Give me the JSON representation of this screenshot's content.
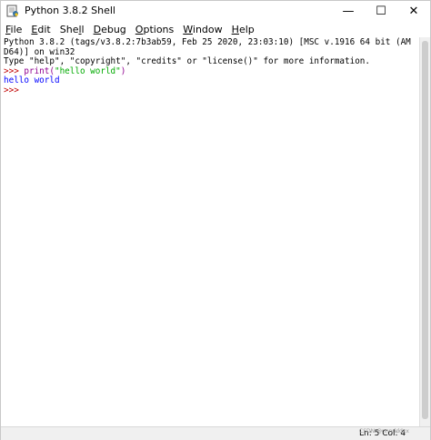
{
  "window": {
    "title": "Python 3.8.2 Shell",
    "minimize_glyph": "—",
    "maximize_glyph": "☐",
    "close_glyph": "✕",
    "icon": "python-idle-icon"
  },
  "menu": {
    "items": [
      {
        "key": "F",
        "rest": "ile"
      },
      {
        "key": "E",
        "rest": "dit"
      },
      {
        "pre": "She",
        "key": "l",
        "rest": "l"
      },
      {
        "key": "D",
        "rest": "ebug"
      },
      {
        "key": "O",
        "rest": "ptions"
      },
      {
        "key": "W",
        "rest": "indow"
      },
      {
        "key": "H",
        "rest": "elp"
      }
    ]
  },
  "shell": {
    "banner_1": "Python 3.8.2 (tags/v3.8.2:7b3ab59, Feb 25 2020, 23:03:10) [MSC v.1916 64 bit (AM",
    "banner_2": "D64)] on win32",
    "banner_3": "Type \"help\", \"copyright\", \"credits\" or \"license()\" for more information.",
    "prompt": ">>> ",
    "input_fn": "print(",
    "input_str": "\"hello world\"",
    "input_close": ")",
    "output": "hello world",
    "prompt_2": ">>> "
  },
  "status": {
    "position": "Ln: 5  Col: 4",
    "watermark": "CSDN @nnndddxx"
  },
  "colors": {
    "prompt": "#c00000",
    "builtin": "#900090",
    "string": "#00aa00",
    "output": "#0000ff"
  }
}
